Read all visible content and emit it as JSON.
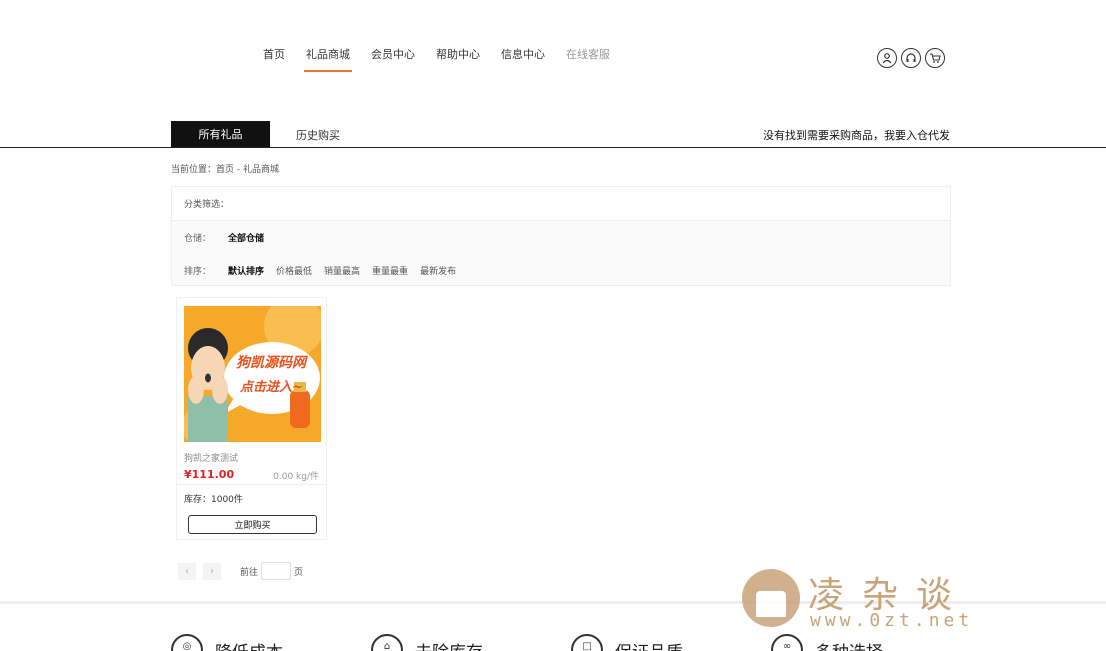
{
  "nav": {
    "items": [
      {
        "label": "首页"
      },
      {
        "label": "礼品商城"
      },
      {
        "label": "会员中心"
      },
      {
        "label": "帮助中心"
      },
      {
        "label": "信息中心"
      },
      {
        "label": "在线客服"
      }
    ],
    "active_index": 1
  },
  "header_icons": [
    "user-icon",
    "headset-icon",
    "cart-icon"
  ],
  "tabs": {
    "all_gifts": "所有礼品",
    "history": "历史购买",
    "right_link": "没有找到需要采购商品，我要入仓代发"
  },
  "breadcrumb": "当前位置：首页 - 礼品商城",
  "filter": {
    "category_label": "分类筛选：",
    "warehouse_label": "仓储：",
    "warehouse_value": "全部仓储",
    "sort_label": "排序：",
    "sort_options": [
      "默认排序",
      "价格最低",
      "销量最高",
      "重量最重",
      "最新发布"
    ]
  },
  "product": {
    "image_text_line1": "狗凯源码网",
    "image_text_line2": "点击进入~",
    "name": "狗凯之家测试",
    "price": "¥111.00",
    "weight": "0.00 kg/件",
    "stock": "库存：1000件",
    "buy_label": "立即购买"
  },
  "pager": {
    "prev": "‹",
    "next": "›",
    "goto_label": "前往",
    "page_suffix": "页"
  },
  "features": [
    {
      "label": "降低成本"
    },
    {
      "label": "去除库存"
    },
    {
      "label": "保证品质"
    },
    {
      "label": "多种选择"
    }
  ],
  "watermark": {
    "cn": "凌杂谈",
    "url": "www.0zt.net"
  },
  "colors": {
    "accent": "#e8772e",
    "price": "#e02020",
    "tab_active_bg": "#111111"
  }
}
